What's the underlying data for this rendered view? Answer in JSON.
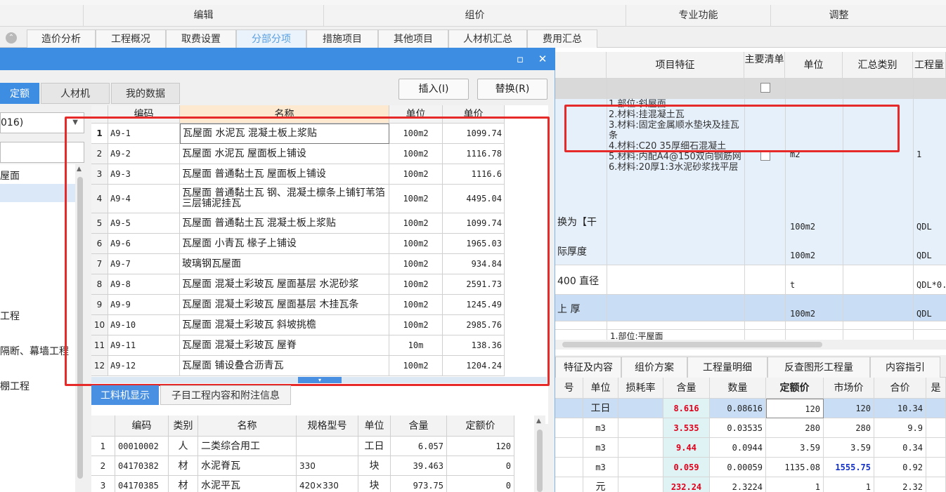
{
  "ribbon": {
    "groups": [
      "编辑",
      "组价",
      "专业功能",
      "调整"
    ]
  },
  "main_tabs": [
    "造价分析",
    "工程概况",
    "取费设置",
    "分部分项",
    "措施项目",
    "其他项目",
    "人材机汇总",
    "费用汇总"
  ],
  "bg_table": {
    "headers": [
      "项目特征",
      "主要清单",
      "单位",
      "汇总类别",
      "工程量"
    ],
    "feature_lines": [
      "1.部位:斜屋面",
      "2.材料:挂混凝土瓦",
      "3.材料:固定金属顺水垫块及挂瓦条",
      "4.材料:C20 35厚细石混凝土",
      "5.材料:内配A4@150双向钢筋网",
      "6.材料:20厚1:3水泥砂浆找平层"
    ],
    "row1": {
      "unit": "m2",
      "qty": "1"
    },
    "partial_texts": [
      "换为【干",
      "际厚度",
      "400 直径",
      "上 厚",
      "1.部位:平屋面"
    ],
    "rows": [
      {
        "unit": "100m2",
        "qty": "QDL"
      },
      {
        "unit": "100m2",
        "qty": "QDL"
      },
      {
        "unit": "t",
        "qty": "QDL*0."
      },
      {
        "unit": "100m2",
        "qty": "QDL"
      }
    ]
  },
  "bottom_tabs": [
    "特征及内容",
    "组价方案",
    "工程量明细",
    "反查图形工程量",
    "内容指引"
  ],
  "bottom_grid": {
    "headers": [
      "号",
      "单位",
      "损耗率",
      "含量",
      "数量",
      "定额价",
      "市场价",
      "合价",
      "是"
    ],
    "rows": [
      {
        "unit": "工日",
        "content": "8.616",
        "qty": "0.08616",
        "quota": "120",
        "market": "120",
        "total": "10.34"
      },
      {
        "unit": "m3",
        "content": "3.535",
        "qty": "0.03535",
        "quota": "280",
        "market": "280",
        "total": "9.9"
      },
      {
        "unit": "m3",
        "content": "9.44",
        "qty": "0.0944",
        "quota": "3.59",
        "market": "3.59",
        "total": "0.34"
      },
      {
        "unit": "m3",
        "content": "0.059",
        "qty": "0.00059",
        "quota": "1135.08",
        "market": "1555.75",
        "total": "0.92"
      },
      {
        "unit": "元",
        "content": "232.24",
        "qty": "2.3224",
        "quota": "1",
        "market": "1",
        "total": "2.32"
      }
    ]
  },
  "dialog": {
    "tabs": [
      "定额",
      "人材机",
      "我的数据"
    ],
    "insert_label": "插入(I)",
    "replace_label": "替换(R)",
    "combo_value": "016)",
    "tree_items": [
      "屋面",
      "工程",
      "隔断、幕墙工程",
      "棚工程"
    ]
  },
  "list_table": {
    "headers": [
      "编码",
      "名称",
      "单位",
      "单价"
    ],
    "rows": [
      {
        "no": "1",
        "code": "A9-1",
        "name": "瓦屋面 水泥瓦 混凝土板上浆贴",
        "unit": "100m2",
        "price": "1099.74"
      },
      {
        "no": "2",
        "code": "A9-2",
        "name": "瓦屋面 水泥瓦 屋面板上铺设",
        "unit": "100m2",
        "price": "1116.78"
      },
      {
        "no": "3",
        "code": "A9-3",
        "name": "瓦屋面 普通黏土瓦 屋面板上铺设",
        "unit": "100m2",
        "price": "1116.6"
      },
      {
        "no": "4",
        "code": "A9-4",
        "name": "瓦屋面 普通黏土瓦 钢、混凝土檩条上铺钉苇箔三层铺泥挂瓦",
        "unit": "100m2",
        "price": "4495.04"
      },
      {
        "no": "5",
        "code": "A9-5",
        "name": "瓦屋面 普通黏土瓦 混凝土板上浆贴",
        "unit": "100m2",
        "price": "1099.74"
      },
      {
        "no": "6",
        "code": "A9-6",
        "name": "瓦屋面 小青瓦 椽子上铺设",
        "unit": "100m2",
        "price": "1965.03"
      },
      {
        "no": "7",
        "code": "A9-7",
        "name": "玻璃钢瓦屋面",
        "unit": "100m2",
        "price": "934.84"
      },
      {
        "no": "8",
        "code": "A9-8",
        "name": "瓦屋面 混凝土彩玻瓦 屋面基层 水泥砂浆",
        "unit": "100m2",
        "price": "2591.73"
      },
      {
        "no": "9",
        "code": "A9-9",
        "name": "瓦屋面 混凝土彩玻瓦 屋面基层 木挂瓦条",
        "unit": "100m2",
        "price": "1245.49"
      },
      {
        "no": "10",
        "code": "A9-10",
        "name": "瓦屋面 混凝土彩玻瓦 斜坡挑檐",
        "unit": "100m2",
        "price": "2985.76"
      },
      {
        "no": "11",
        "code": "A9-11",
        "name": "瓦屋面 混凝土彩玻瓦 屋脊",
        "unit": "10m",
        "price": "138.36"
      },
      {
        "no": "12",
        "code": "A9-12",
        "name": "瓦屋面 铺设叠合沥青瓦",
        "unit": "100m2",
        "price": "1204.24"
      }
    ]
  },
  "lower_tabs": [
    "工料机显示",
    "子目工程内容和附注信息"
  ],
  "sub_table": {
    "headers": [
      "编码",
      "类别",
      "名称",
      "规格型号",
      "单位",
      "含量",
      "定额价"
    ],
    "rows": [
      {
        "no": "1",
        "code": "00010002",
        "type": "人",
        "name": "二类综合用工",
        "spec": "",
        "unit": "工日",
        "content": "6.057",
        "price": "120"
      },
      {
        "no": "2",
        "code": "04170382",
        "type": "材",
        "name": "水泥脊瓦",
        "spec": "330",
        "unit": "块",
        "content": "39.463",
        "price": "0"
      },
      {
        "no": "3",
        "code": "04170385",
        "type": "材",
        "name": "水泥平瓦",
        "spec": "420×330",
        "unit": "块",
        "content": "973.75",
        "price": "0"
      }
    ]
  },
  "colors": {
    "dialog_title": "#3d8ee3",
    "highlight_box": "#e62a2a",
    "content_red": "#e0001a",
    "market_blue": "#1330c8"
  }
}
